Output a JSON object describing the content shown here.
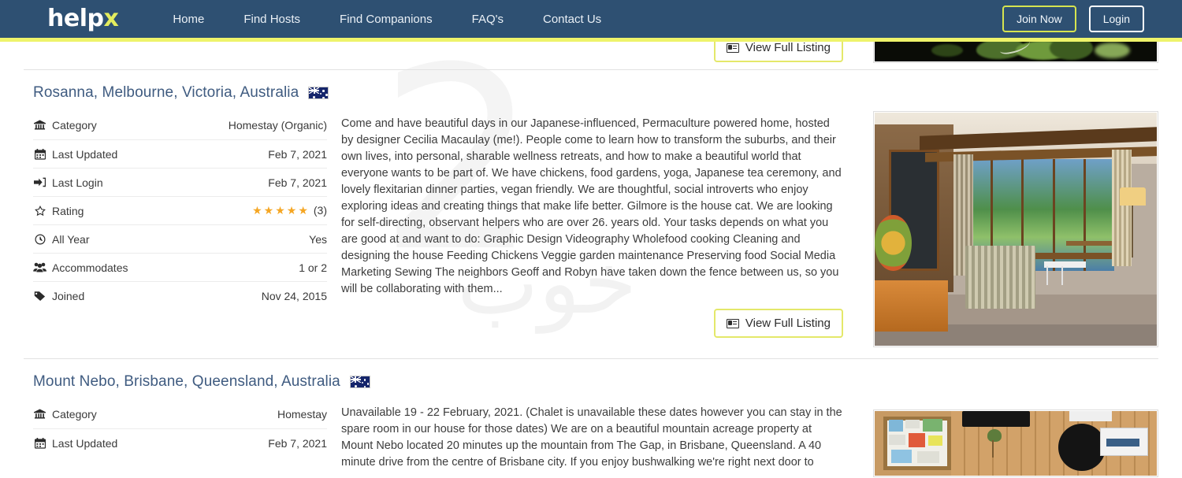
{
  "navbar": {
    "brand_main": "help",
    "brand_accent": "x",
    "links": [
      {
        "label": "Home",
        "name": "nav-home"
      },
      {
        "label": "Find Hosts",
        "name": "nav-find-hosts"
      },
      {
        "label": "Find Companions",
        "name": "nav-find-companions"
      },
      {
        "label": "FAQ's",
        "name": "nav-faqs"
      },
      {
        "label": "Contact Us",
        "name": "nav-contact-us"
      }
    ],
    "join_label": "Join Now",
    "login_label": "Login",
    "bg_color": "#2e5072",
    "accent_color": "#eef36a"
  },
  "common": {
    "view_full_listing": "View Full Listing"
  },
  "listings": [
    {
      "title": "",
      "partial": true
    },
    {
      "title": "Rosanna, Melbourne, Victoria, Australia",
      "flag": "australia-flag",
      "attributes": [
        {
          "icon": "bank-icon",
          "label": "Category",
          "value": "Homestay (Organic)"
        },
        {
          "icon": "calendar-icon",
          "label": "Last Updated",
          "value": "Feb 7, 2021"
        },
        {
          "icon": "sign-in-icon",
          "label": "Last Login",
          "value": "Feb 7, 2021"
        },
        {
          "icon": "star-icon",
          "label": "Rating",
          "value": "",
          "stars": 5,
          "rating_count": "(3)"
        },
        {
          "icon": "clock-icon",
          "label": "All Year",
          "value": "Yes"
        },
        {
          "icon": "users-icon",
          "label": "Accommodates",
          "value": "1 or 2"
        },
        {
          "icon": "tag-icon",
          "label": "Joined",
          "value": "Nov 24, 2015"
        }
      ],
      "description": "Come and have beautiful days in our Japanese-influenced, Permaculture powered home, hosted by designer Cecilia Macaulay (me!). People come to learn how to transform the suburbs, and their own lives, into personal, sharable wellness retreats, and how to make a beautiful world that everyone wants to be part of.   We have chickens, food gardens, yoga, Japanese tea ceremony, and lovely flexitarian dinner parties, vegan friendly. We are thoughtful, social introverts who enjoy exploring ideas and creating things that make life better. Gilmore is the house cat.  We are looking for self-directing, observant helpers who are over 26. years old.  Your tasks depends on what you are good at and want to do: Graphic Design Videography Wholefood cooking Cleaning and designing the house Feeding Chickens  Veggie garden maintenance Preserving food Social Media Marketing Sewing The neighbors Geoff and Robyn have taken down the fence between us, so you will be collaborating with them...",
      "photo": "modern-house-interior-photo"
    },
    {
      "title": "Mount Nebo, Brisbane, Queensland, Australia",
      "flag": "australia-flag",
      "attributes": [
        {
          "icon": "bank-icon",
          "label": "Category",
          "value": "Homestay"
        },
        {
          "icon": "calendar-icon",
          "label": "Last Updated",
          "value": "Feb 7, 2021"
        }
      ],
      "description": "Unavailable 19 - 22 February, 2021. (Chalet is unavailable these dates however you can stay in the spare room in our house for those dates) We are on a beautiful mountain acreage property at Mount Nebo located 20 minutes up the mountain from The Gap, in Brisbane, Queensland. A 40 minute drive from the centre of Brisbane city. If you enjoy bushwalking we're right next door to",
      "photo": "cabin-wall-noticeboard-photo"
    }
  ],
  "watermark": {
    "number": "2",
    "text": "خوب"
  }
}
